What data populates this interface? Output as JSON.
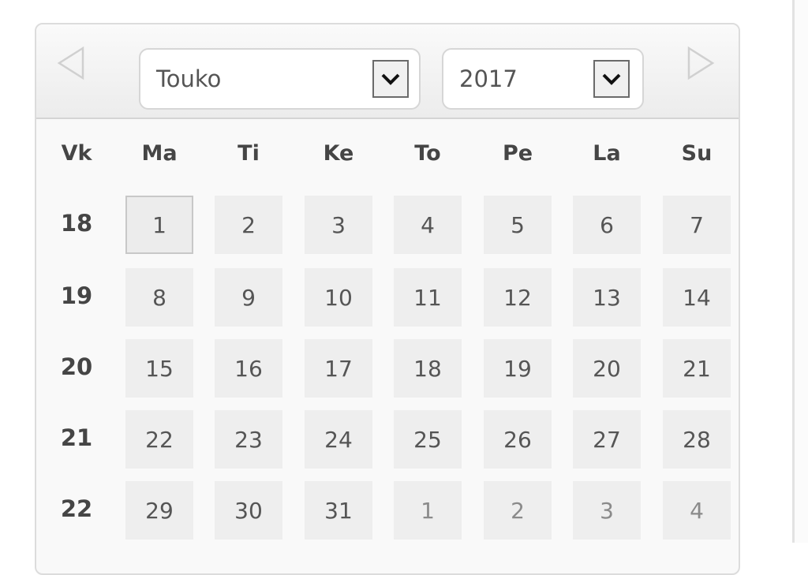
{
  "datepicker": {
    "prev_icon": "triangle-left-icon",
    "next_icon": "triangle-right-icon",
    "month_select": {
      "value": "Touko",
      "arrow_icon": "chevron-down-icon"
    },
    "year_select": {
      "value": "2017",
      "arrow_icon": "chevron-down-icon"
    },
    "headers": [
      "Vk",
      "Ma",
      "Ti",
      "Ke",
      "To",
      "Pe",
      "La",
      "Su"
    ],
    "weeks": [
      {
        "week": "18",
        "days": [
          {
            "d": "1",
            "other": false,
            "today": true
          },
          {
            "d": "2",
            "other": false
          },
          {
            "d": "3",
            "other": false
          },
          {
            "d": "4",
            "other": false
          },
          {
            "d": "5",
            "other": false
          },
          {
            "d": "6",
            "other": false
          },
          {
            "d": "7",
            "other": false
          }
        ]
      },
      {
        "week": "19",
        "days": [
          {
            "d": "8",
            "other": false
          },
          {
            "d": "9",
            "other": false
          },
          {
            "d": "10",
            "other": false
          },
          {
            "d": "11",
            "other": false
          },
          {
            "d": "12",
            "other": false
          },
          {
            "d": "13",
            "other": false
          },
          {
            "d": "14",
            "other": false
          }
        ]
      },
      {
        "week": "20",
        "days": [
          {
            "d": "15",
            "other": false
          },
          {
            "d": "16",
            "other": false
          },
          {
            "d": "17",
            "other": false
          },
          {
            "d": "18",
            "other": false
          },
          {
            "d": "19",
            "other": false
          },
          {
            "d": "20",
            "other": false
          },
          {
            "d": "21",
            "other": false
          }
        ]
      },
      {
        "week": "21",
        "days": [
          {
            "d": "22",
            "other": false
          },
          {
            "d": "23",
            "other": false
          },
          {
            "d": "24",
            "other": false
          },
          {
            "d": "25",
            "other": false
          },
          {
            "d": "26",
            "other": false
          },
          {
            "d": "27",
            "other": false
          },
          {
            "d": "28",
            "other": false
          }
        ]
      },
      {
        "week": "22",
        "days": [
          {
            "d": "29",
            "other": false
          },
          {
            "d": "30",
            "other": false
          },
          {
            "d": "31",
            "other": false
          },
          {
            "d": "1",
            "other": true
          },
          {
            "d": "2",
            "other": true
          },
          {
            "d": "3",
            "other": true
          },
          {
            "d": "4",
            "other": true
          }
        ]
      }
    ]
  }
}
